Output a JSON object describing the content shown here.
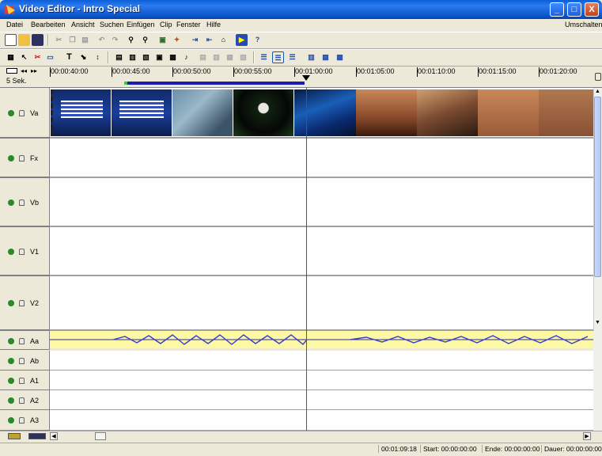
{
  "window": {
    "title": "Video Editor - Intro Special",
    "min": "_",
    "max": "□",
    "close": "X"
  },
  "menu": {
    "items": [
      "Datei",
      "Bearbeiten",
      "Ansicht",
      "Suchen",
      "Einfügen",
      "Clip",
      "Fenster",
      "Hilfe"
    ],
    "right": "Umschalten"
  },
  "ruler": {
    "times": [
      "00:00:40:00",
      "00:00:45:00",
      "00:00:50:00",
      "00:00:55:00",
      "00:01:00:00",
      "00:01:05:00",
      "00:01:10:00",
      "00:01:15:00",
      "00:01:20:00"
    ],
    "zoom": "5 Sek."
  },
  "tracks": {
    "video": [
      "Va",
      "Fx",
      "Vb",
      "V1",
      "V2"
    ],
    "audio": [
      "Aa",
      "Ab",
      "A1",
      "A2",
      "A3"
    ]
  },
  "status": {
    "position": "00:01:09:18",
    "start": "Start: 00:00:00:00",
    "end": "Ende: 00:00:00:00",
    "duration": "Dauer: 00:00:00:00"
  },
  "colors": {
    "titlebar": "#0a54c8",
    "audio_clip": "#fcf8a3",
    "range_bar": "#1c1cb0"
  }
}
